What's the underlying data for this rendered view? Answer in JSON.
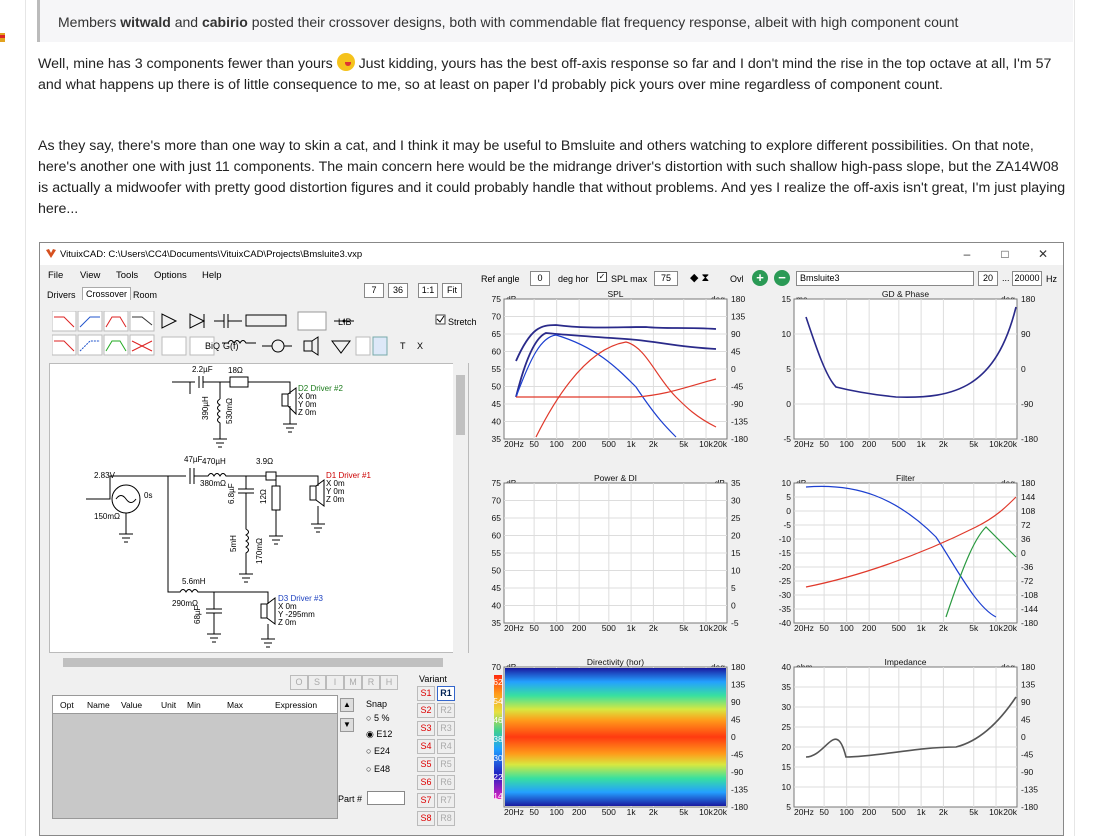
{
  "quote": {
    "prefix": "Members",
    "user1": "witwald",
    "and": "and",
    "user2": "cabirio",
    "suffix": "posted their crossover designs, both with commendable flat frequency response, albeit with high component count"
  },
  "post": {
    "p1_before_emoji": "Well, mine has 3 components fewer than yours",
    "p1_after_emoji": "Just kidding, yours has the best off-axis response so far and I don't mind the rise in the top octave at all, I'm 57 and what happens up there is of little consequence to me, so at least on paper I'd probably pick yours over mine regardless of component count.",
    "p2": "As they say, there's more than one way to skin a cat, and I think it may be useful to Bmsluite and others watching to explore different possibilities. On that note, here's another one with just 11 components. The main concern here would be the midrange driver's distortion with such shallow high-pass slope, but the ZA14W08 is actually a midwoofer with pretty good distortion figures and it could probably handle that without problems. And yes I realize the off-axis isn't great, I'm just playing here..."
  },
  "app": {
    "title": "VituixCAD: C:\\Users\\CC4\\Documents\\VituixCAD\\Projects\\Bmsluite3.vxp",
    "menu": [
      "File",
      "View",
      "Tools",
      "Options",
      "Help"
    ],
    "tabs": [
      "Drivers",
      "Crossover",
      "Room"
    ],
    "zoom_buttons": [
      "7",
      "36",
      "1:1",
      "Fit"
    ],
    "lib_button": "LIB",
    "stretch_label": "Stretch",
    "biq": "BiQ",
    "gf": "G(f)",
    "t": "T",
    "x": "X",
    "ref_angle_label": "Ref angle",
    "ref_angle_value": "0",
    "deg_hor": "deg hor",
    "spl_max_label": "SPL max",
    "spl_max_value": "75",
    "ovl": "Ovl",
    "project_name": "Bmsluite3",
    "freq_min": "20",
    "freq_sep": "...",
    "freq_max": "20000",
    "hz": "Hz"
  },
  "schematic": {
    "c1": "2.2µF",
    "r1": "18Ω",
    "l1": "390µH",
    "r_l1": "530mΩ",
    "d2": [
      "D2 Driver #2",
      "X 0m",
      "Y 0m",
      "Z 0m"
    ],
    "c2": "47µF",
    "l2": "470µH",
    "r_l2": "380mΩ",
    "r2": "3.9Ω",
    "c3": "6.8µF",
    "r3": "12Ω",
    "l3": "5mH",
    "r_l3": "170mΩ",
    "d1": [
      "D1 Driver #1",
      "X 0m",
      "Y 0m",
      "Z 0m"
    ],
    "src": [
      "2.83V",
      "0s",
      "150mΩ"
    ],
    "l4": "5.6mH",
    "r_l4": "290mΩ",
    "c4": "68µF",
    "d3": [
      "D3 Driver #3",
      "X 0m",
      "Y -295mm",
      "Z 0m"
    ]
  },
  "param_table": {
    "headers": [
      "Opt",
      "Name",
      "Value",
      "Unit",
      "Min",
      "Max",
      "Expression"
    ],
    "osmrh": [
      "O",
      "S",
      "I",
      "M",
      "R",
      "H"
    ]
  },
  "snap": {
    "label": "Snap",
    "options": [
      "5 %",
      "E12",
      "E24",
      "E48"
    ],
    "selected": "E12",
    "part_label": "Part #"
  },
  "variant": {
    "label": "Variant",
    "s": [
      "S1",
      "S2",
      "S3",
      "S4",
      "S5",
      "S6",
      "S7",
      "S8"
    ],
    "r": [
      "R1",
      "R2",
      "R3",
      "R4",
      "R5",
      "R6",
      "R7",
      "R8"
    ]
  },
  "plots": {
    "spl": {
      "title": "SPL",
      "yl": "dB",
      "yr": "deg",
      "left": [
        "75",
        "70",
        "65",
        "60",
        "55",
        "50",
        "45",
        "40",
        "35"
      ],
      "right": [
        "180",
        "135",
        "90",
        "45",
        "0",
        "-45",
        "-90",
        "-135",
        "-180"
      ]
    },
    "gd": {
      "title": "GD & Phase",
      "yl": "ms",
      "yr": "deg",
      "left": [
        "15",
        "10",
        "5",
        "0",
        "-5"
      ],
      "right": [
        "180",
        "90",
        "0",
        "-90",
        "-180"
      ]
    },
    "pw": {
      "title": "Power & DI",
      "yl": "dB",
      "yr": "dB",
      "left": [
        "75",
        "70",
        "65",
        "60",
        "55",
        "50",
        "45",
        "40",
        "35"
      ],
      "right": [
        "35",
        "30",
        "25",
        "20",
        "15",
        "10",
        "5",
        "0",
        "-5"
      ]
    },
    "filter": {
      "title": "Filter",
      "yl": "dB",
      "yr": "deg",
      "left": [
        "10",
        "5",
        "0",
        "-5",
        "-10",
        "-15",
        "-20",
        "-25",
        "-30",
        "-35",
        "-40"
      ],
      "right": [
        "180",
        "144",
        "108",
        "72",
        "36",
        "0",
        "-36",
        "-72",
        "-108",
        "-144",
        "-180"
      ]
    },
    "dir": {
      "title": "Directivity (hor)",
      "yl": "dB",
      "yr": "deg",
      "left": [
        "70"
      ],
      "right": [
        "180",
        "135",
        "90",
        "45",
        "0",
        "-45",
        "-90",
        "-135",
        "-180"
      ],
      "scale": [
        "62",
        "54",
        "46",
        "38",
        "30",
        "22",
        "14"
      ]
    },
    "imp": {
      "title": "Impedance",
      "yl": "ohm",
      "yr": "deg",
      "left": [
        "40",
        "35",
        "30",
        "25",
        "20",
        "15",
        "10",
        "5"
      ],
      "right": [
        "180",
        "135",
        "90",
        "45",
        "0",
        "-45",
        "-90",
        "-135",
        "-180"
      ]
    },
    "xticks": [
      "20Hz",
      "50",
      "100",
      "200",
      "500",
      "1k",
      "2k",
      "5k",
      "10k",
      "20k"
    ]
  }
}
